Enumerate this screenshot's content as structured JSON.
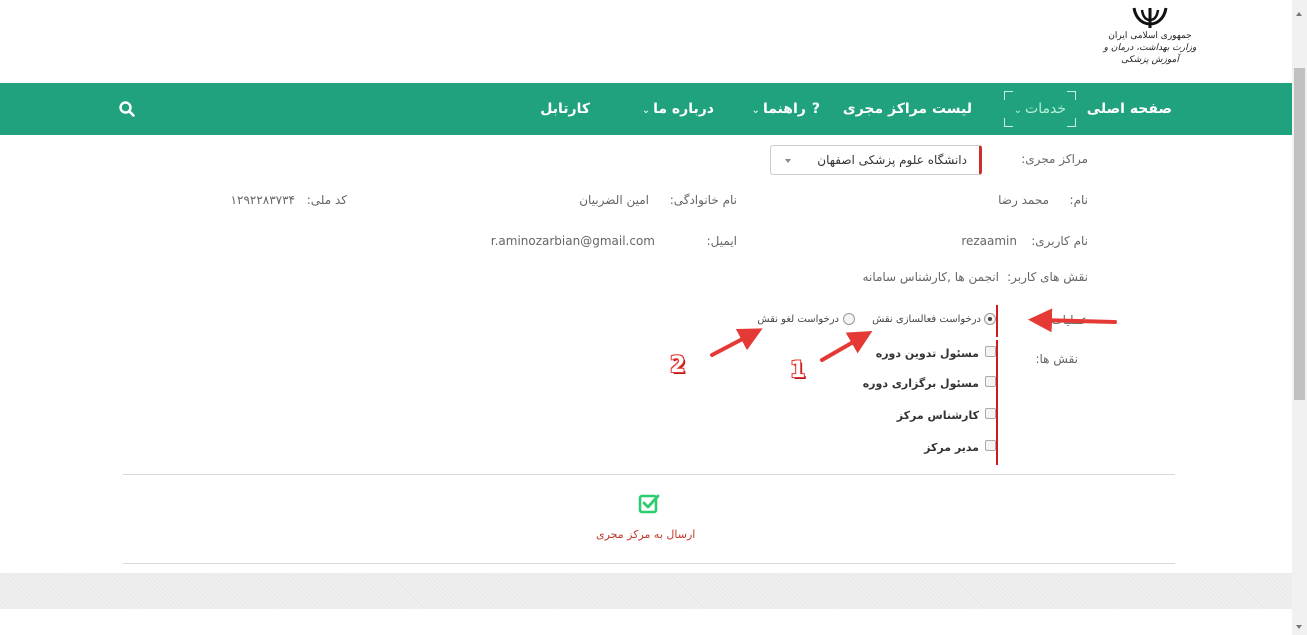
{
  "logo": {
    "line1": "جمهوری اسلامی ایران",
    "line2": "وزارت بهداشت، درمان و آموزش پزشکی"
  },
  "nav": {
    "home": "صفحه اصلی",
    "services": "خدمات",
    "centers": "لیست مراکز مجری",
    "help": "راهنما",
    "about": "درباره ما",
    "cartable": "کارتابل",
    "help_icon": "?",
    "search_icon": "search-icon"
  },
  "form": {
    "center_label": "مراکز مجری:",
    "center_value": "دانشگاه علوم پزشکی اصفهان",
    "name_label": "نام:",
    "name_value": "محمد رضا",
    "family_label": "نام خانوادگی:",
    "family_value": "امین الضربیان",
    "national_label": "کد ملی:",
    "national_value": "۱۲۹۲۲۸۳۷۳۴",
    "username_label": "نام کاربری:",
    "username_value": "rezaamin",
    "email_label": "ایمیل:",
    "email_value": "r.aminozarbian@gmail.com",
    "roles_label": "نقش های کاربر:",
    "roles_value": "انجمن ها ,کارشناس سامانه",
    "ops_label": "عملیات:",
    "op_activate": "درخواست فعالسازی نقش",
    "op_cancel": "درخواست لغو نقش",
    "role_list_label": "نقش ها:",
    "roles": [
      {
        "label": "مسئول تدوین دوره"
      },
      {
        "label": "مسئول برگزاری دوره"
      },
      {
        "label": "کارشناس مرکز"
      },
      {
        "label": "مدیر مرکز"
      }
    ],
    "submit_label": "ارسال به مرکز مجری"
  },
  "annotations": {
    "one": "1",
    "two": "2"
  },
  "colors": {
    "nav_bg": "#21a27e",
    "accent_red": "#d2191c",
    "submit_green": "#2ecc71"
  }
}
